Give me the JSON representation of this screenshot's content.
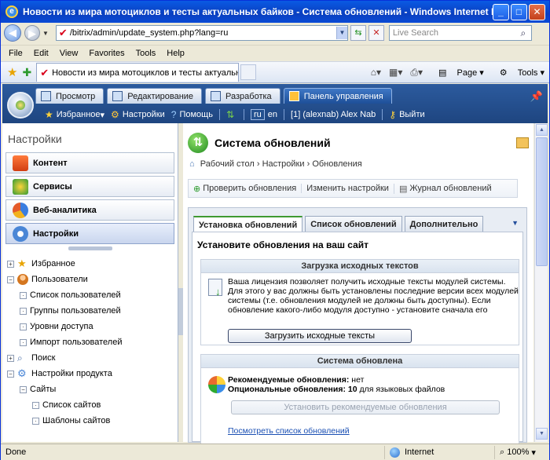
{
  "window": {
    "title": "Новости из мира мотоциклов и тесты актуальных байков - Система обновлений - Windows Internet Explorer",
    "minimize": "_",
    "maximize": "□",
    "close": "✕"
  },
  "address": {
    "url": "/bitrix/admin/update_system.php?lang=ru",
    "search_placeholder": "Live Search"
  },
  "menu": [
    "File",
    "Edit",
    "View",
    "Favorites",
    "Tools",
    "Help"
  ],
  "browser_tab": {
    "title": "Новости из мира мотоциклов и тесты актуальных ..."
  },
  "command_bar": {
    "page": "Page",
    "tools": "Tools"
  },
  "admin": {
    "tabs": [
      "Просмотр",
      "Редактирование",
      "Разработка",
      "Панель управления"
    ],
    "tools": {
      "favorites": "Избранное",
      "settings": "Настройки",
      "help": "Помощь",
      "lang_ru": "ru",
      "lang_en": "en",
      "user": "[1] (alexnab) Alex Nab",
      "logout": "Выйти"
    }
  },
  "sidebar": {
    "title": "Настройки",
    "sections": [
      "Контент",
      "Сервисы",
      "Веб-аналитика",
      "Настройки"
    ],
    "tree": [
      {
        "label": "Избранное",
        "toggle": "+",
        "level": 0
      },
      {
        "label": "Пользователи",
        "toggle": "−",
        "level": 0
      },
      {
        "label": "Список пользователей",
        "toggle": "",
        "level": 1
      },
      {
        "label": "Группы пользователей",
        "toggle": "",
        "level": 1
      },
      {
        "label": "Уровни доступа",
        "toggle": "",
        "level": 1
      },
      {
        "label": "Импорт пользователей",
        "toggle": "",
        "level": 1
      },
      {
        "label": "Поиск",
        "toggle": "+",
        "level": 0
      },
      {
        "label": "Настройки продукта",
        "toggle": "−",
        "level": 0
      },
      {
        "label": "Сайты",
        "toggle": "−",
        "level": 1
      },
      {
        "label": "Список сайтов",
        "toggle": "",
        "level": 2
      },
      {
        "label": "Шаблоны сайтов",
        "toggle": "",
        "level": 2
      }
    ]
  },
  "main": {
    "title": "Система обновлений",
    "breadcrumb": {
      "home": "Рабочий стол",
      "settings": "Настройки",
      "current": "Обновления"
    },
    "toolbar": [
      "Проверить обновления",
      "Изменить настройки",
      "Журнал обновлений"
    ],
    "tabs": [
      "Установка обновлений",
      "Список обновлений",
      "Дополнительно"
    ],
    "heading": "Установите обновления на ваш сайт",
    "source_box": {
      "title": "Загрузка исходных текстов",
      "text": "Ваша лицензия позволяет получить исходные тексты модулей системы. Для этого у вас должны быть установлены последние версии всех модулей системы (т.е. обновления модулей не должны быть доступны). Если обновление какого-либо модуля доступно - установите сначала его",
      "button": "Загрузить исходные тексты"
    },
    "status_box": {
      "title": "Система обновлена",
      "recommended_label": "Рекомендуемые обновления:",
      "recommended_value": "нет",
      "optional_label": "Опциональные обновления:",
      "optional_value": "10",
      "optional_suffix": "для языковых файлов",
      "button": "Установить рекомендуемые обновления",
      "link": "Посмотреть список обновлений"
    }
  },
  "status": {
    "text": "Done",
    "zone": "Internet",
    "zoom": "100%"
  }
}
